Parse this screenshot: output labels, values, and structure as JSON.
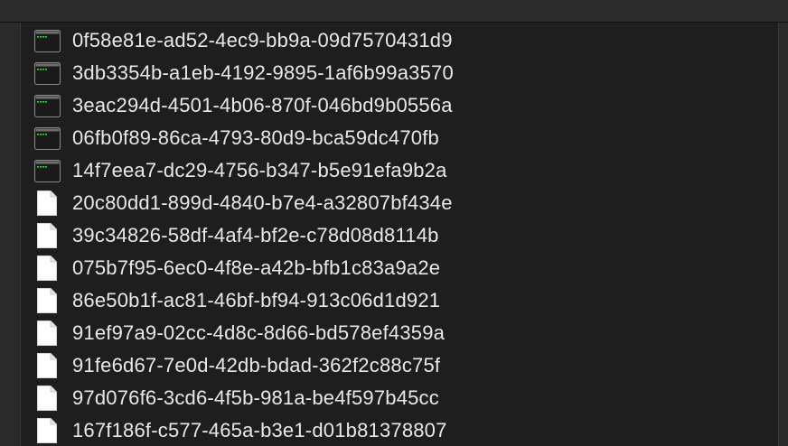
{
  "files": [
    {
      "name": "0f58e81e-ad52-4ec9-bb9a-09d7570431d9",
      "type": "executable",
      "icon": "terminal-executable-icon"
    },
    {
      "name": "3db3354b-a1eb-4192-9895-1af6b99a3570",
      "type": "executable",
      "icon": "terminal-executable-icon"
    },
    {
      "name": "3eac294d-4501-4b06-870f-046bd9b0556a",
      "type": "executable",
      "icon": "terminal-executable-icon"
    },
    {
      "name": "06fb0f89-86ca-4793-80d9-bca59dc470fb",
      "type": "executable",
      "icon": "terminal-executable-icon"
    },
    {
      "name": "14f7eea7-dc29-4756-b347-b5e91efa9b2a",
      "type": "executable",
      "icon": "terminal-executable-icon"
    },
    {
      "name": "20c80dd1-899d-4840-b7e4-a32807bf434e",
      "type": "document",
      "icon": "blank-document-icon"
    },
    {
      "name": "39c34826-58df-4af4-bf2e-c78d08d8114b",
      "type": "document",
      "icon": "blank-document-icon"
    },
    {
      "name": "075b7f95-6ec0-4f8e-a42b-bfb1c83a9a2e",
      "type": "document",
      "icon": "blank-document-icon"
    },
    {
      "name": "86e50b1f-ac81-46bf-bf94-913c06d1d921",
      "type": "document",
      "icon": "blank-document-icon"
    },
    {
      "name": "91ef97a9-02cc-4d8c-8d66-bd578ef4359a",
      "type": "document",
      "icon": "blank-document-icon"
    },
    {
      "name": "91fe6d67-7e0d-42db-bdad-362f2c88c75f",
      "type": "document",
      "icon": "blank-document-icon"
    },
    {
      "name": "97d076f6-3cd6-4f5b-981a-be4f597b45cc",
      "type": "document",
      "icon": "blank-document-icon"
    },
    {
      "name": "167f186f-c577-465a-b3e1-d01b81378807",
      "type": "document",
      "icon": "blank-document-icon"
    }
  ],
  "colors": {
    "background": "#1e1e1e",
    "text": "#e8e8e8",
    "terminal_green": "#3fd13f"
  }
}
